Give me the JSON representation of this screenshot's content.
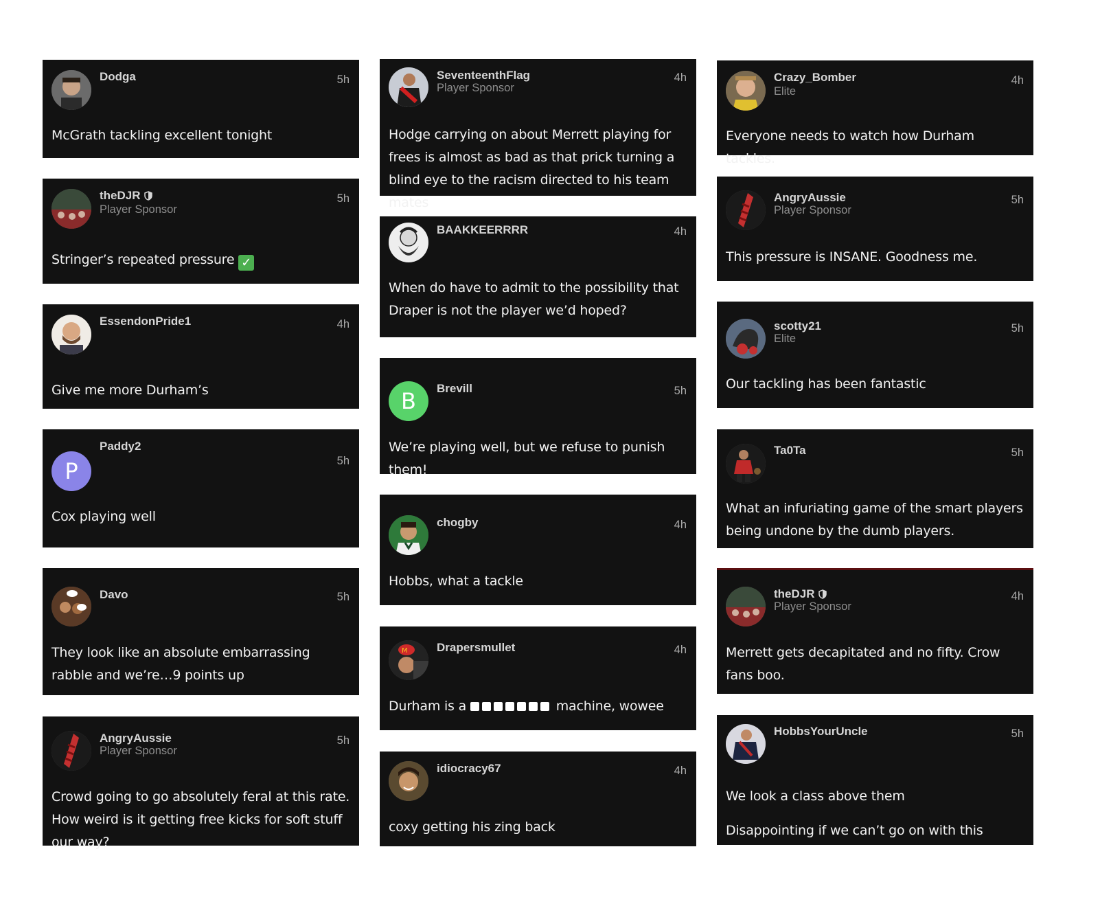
{
  "columns": [
    [
      {
        "username": "Dodga",
        "role": "",
        "time": "5h",
        "text": [
          "McGrath tackling excellent tonight"
        ]
      },
      {
        "username": "theDJR",
        "shield": true,
        "role": "Player Sponsor",
        "time": "5h",
        "text": [
          "Stringer’s repeated pressure"
        ],
        "emoji": "check-mark"
      },
      {
        "username": "EssendonPride1",
        "role": "",
        "time": "4h",
        "text": [
          "Give me more Durham’s"
        ]
      },
      {
        "username": "Paddy2",
        "role": "",
        "time": "5h",
        "avatar_letter": "P",
        "avatar_color": "#8a84e8",
        "text": [
          "Cox playing well"
        ]
      },
      {
        "username": "Davo",
        "role": "",
        "time": "5h",
        "text": [
          "They look like an absolute embarrassing rabble and we’re…9 points up"
        ]
      },
      {
        "username": "AngryAussie",
        "role": "Player Sponsor",
        "time": "5h",
        "text": [
          "Crowd going to go absolutely feral at this rate. How weird is it getting free kicks for soft stuff our way?"
        ]
      }
    ],
    [
      {
        "username": "SeventeenthFlag",
        "role": "Player Sponsor",
        "time": "4h",
        "text": [
          "Hodge carrying on about Merrett playing for frees is almost as bad as that prick turning a blind eye to the racism directed to his team mates"
        ]
      },
      {
        "username": "BAAKKEERRRR",
        "role": "",
        "time": "4h",
        "text": [
          "When do have to admit to the possibility that Draper is not the player we’d hoped?"
        ]
      },
      {
        "username": "Brevill",
        "role": "",
        "time": "5h",
        "avatar_letter": "B",
        "avatar_color": "#58d36a",
        "text": [
          "We’re playing well, but we refuse to punish them!"
        ]
      },
      {
        "username": "chogby",
        "role": "",
        "time": "4h",
        "text": [
          "Hobbs, what a tackle"
        ]
      },
      {
        "username": "Drapersmullet",
        "role": "",
        "time": "4h",
        "text_before": "Durham is a",
        "text_after": "machine, wowee",
        "censor_count": 7
      },
      {
        "username": "idiocracy67",
        "role": "",
        "time": "4h",
        "text": [
          "coxy getting his zing back"
        ]
      }
    ],
    [
      {
        "username": "Crazy_Bomber",
        "role": "Elite",
        "time": "4h",
        "text": [
          "Everyone needs to watch how Durham tackles."
        ]
      },
      {
        "username": "AngryAussie",
        "role": "Player Sponsor",
        "time": "5h",
        "text": [
          "This pressure is INSANE. Goodness me."
        ]
      },
      {
        "username": "scotty21",
        "role": "Elite",
        "time": "5h",
        "text": [
          "Our tackling has been fantastic"
        ]
      },
      {
        "username": "Ta0Ta",
        "role": "",
        "time": "5h",
        "text": [
          "What an infuriating game of the smart players being undone by the dumb players."
        ]
      },
      {
        "username": "theDJR",
        "shield": true,
        "role": "Player Sponsor",
        "time": "4h",
        "text": [
          "Merrett gets decapitated and no fifty. Crow fans boo."
        ]
      },
      {
        "username": "HobbsYourUncle",
        "role": "",
        "time": "5h",
        "text": [
          "We look a class above them",
          "Disappointing if we can’t go on with this"
        ]
      }
    ]
  ]
}
